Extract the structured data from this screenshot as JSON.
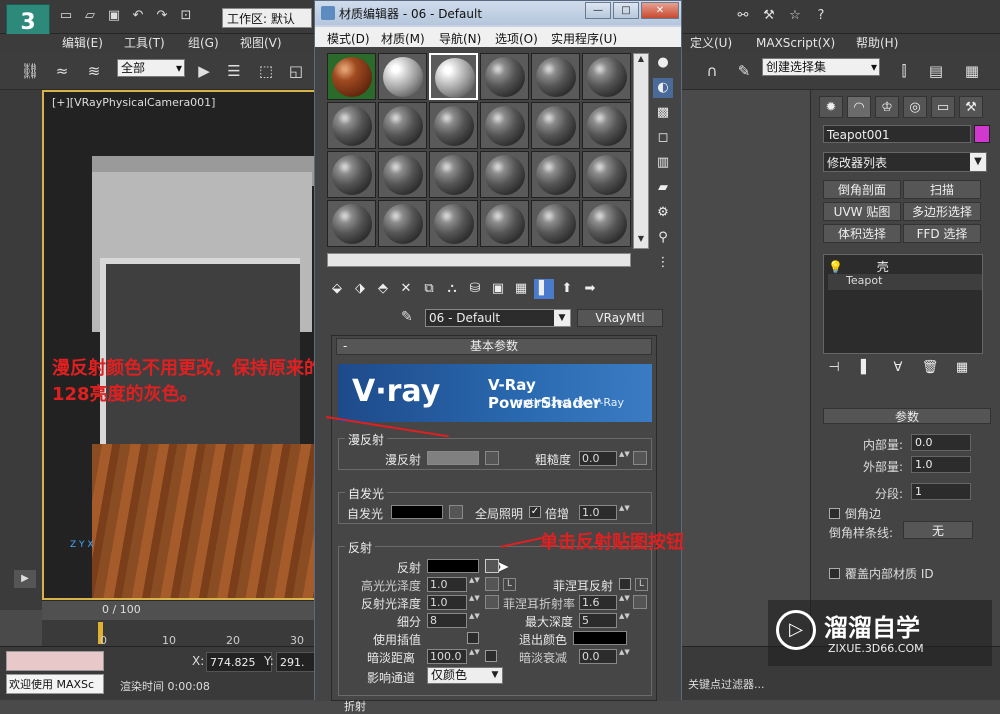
{
  "app": {
    "workspace_label": "工作区: 默认",
    "logo": "3"
  },
  "main_menu": [
    "编辑(E)",
    "工具(T)",
    "组(G)",
    "视图(V)",
    "定义(U)",
    "MAXScript(X)",
    "帮助(H)"
  ],
  "toolbar": {
    "selection_filter": "全部",
    "named_selection": "创建选择集"
  },
  "viewport": {
    "label": "[+][VRayPhysicalCamera001]",
    "annotation": "漫反射颜色不用更改，保持原来的128亮度的灰色。",
    "axis": "Z Y X"
  },
  "timeline": {
    "frame": "0 / 100",
    "ticks": [
      "0",
      "10",
      "20",
      "30"
    ]
  },
  "status": {
    "welcome": "欢迎使用 MAXSc",
    "x_label": "X:",
    "x_value": "774.825",
    "y_label": "Y:",
    "y_value": "291.",
    "render_time": "渲染时间  0:00:08",
    "key_filter": "关键点过滤器..."
  },
  "command_panel": {
    "object_name": "Teapot001",
    "object_color": "#d038d0",
    "modifier_list": "修改器列表",
    "mod_buttons": [
      "倒角剖面",
      "扫描",
      "UVW 贴图",
      "多边形选择",
      "体积选择",
      "FFD 选择"
    ],
    "stack": {
      "group": "壳",
      "base": "Teapot"
    },
    "rollout": "参数",
    "inner_amount_label": "内部量:",
    "inner_amount": "0.0",
    "outer_amount_label": "外部量:",
    "outer_amount": "1.0",
    "segments_label": "分段:",
    "segments": "1",
    "bevel_edges_label": "倒角边",
    "bevel_spline_label": "倒角样条线:",
    "bevel_spline_value": "无",
    "override_inner_label": "覆盖内部材质 ID"
  },
  "material_editor": {
    "title": "材质编辑器 - 06 - Default",
    "menu": [
      "模式(D)",
      "材质(M)",
      "导航(N)",
      "选项(O)",
      "实用程序(U)"
    ],
    "material_name": "06 - Default",
    "material_type": "VRayMtl",
    "rollout_title": "基本参数",
    "banner": {
      "logo": "V·ray",
      "title": "V-Ray PowerShader",
      "subtitle": "optimized for V-Ray"
    },
    "diffuse": {
      "group": "漫反射",
      "diffuse_label": "漫反射",
      "diffuse_color": "#808080",
      "roughness_label": "粗糙度",
      "roughness": "0.0"
    },
    "self_illum": {
      "group": "自发光",
      "label": "自发光",
      "color": "#000000",
      "gi_label": "全局照明",
      "gi_checked": "✓",
      "mult_label": "倍增",
      "mult": "1.0"
    },
    "reflection": {
      "group": "反射",
      "reflect_label": "反射",
      "reflect_color": "#000000",
      "hilight_gloss_label": "高光光泽度",
      "hilight_gloss": "1.0",
      "lock": "L",
      "fresnel_label": "菲涅耳反射",
      "refl_gloss_label": "反射光泽度",
      "refl_gloss": "1.0",
      "fresnel_ior_label": "菲涅耳折射率",
      "fresnel_ior": "1.6",
      "subdivs_label": "细分",
      "subdivs": "8",
      "max_depth_label": "最大深度",
      "max_depth": "5",
      "interp_label": "使用插值",
      "exit_color_label": "退出颜色",
      "exit_color": "#000000",
      "dim_dist_label": "暗淡距离",
      "dim_dist": "100.0",
      "dim_falloff_label": "暗淡衰减",
      "dim_falloff": "0.0",
      "affect_label": "影响通道",
      "affect_value": "仅颜色",
      "next_group": "折射"
    },
    "annotation": "单击反射贴图按钮"
  },
  "watermark": {
    "text": "溜溜自学",
    "url": "ZIXUE.3D66.COM"
  }
}
